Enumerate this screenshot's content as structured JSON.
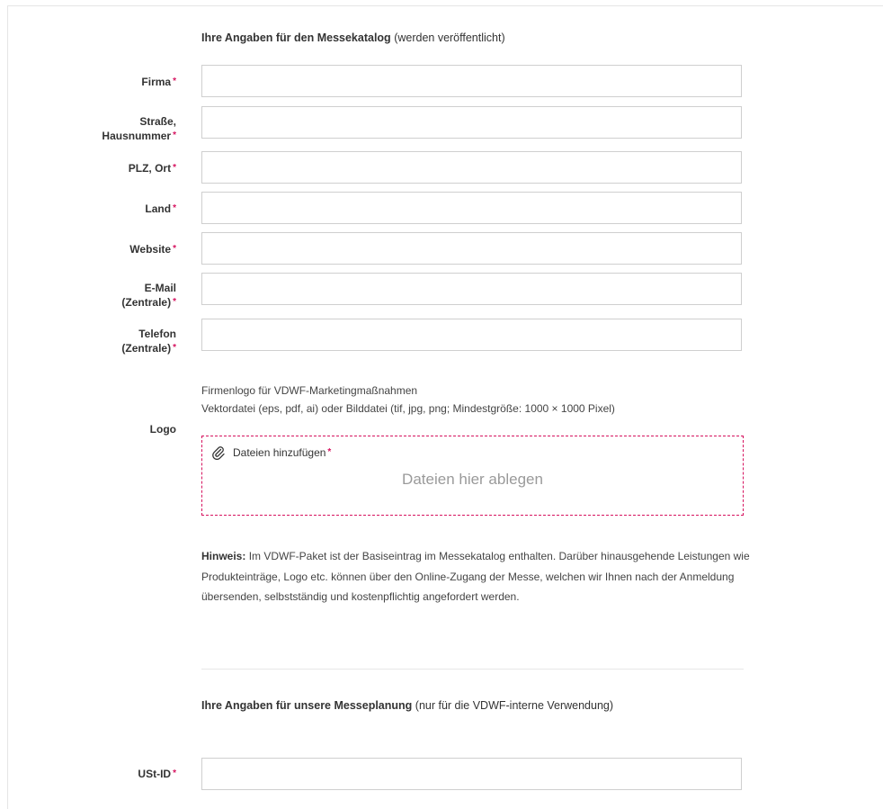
{
  "catalog_section": {
    "heading_bold": "Ihre Angaben für den Messekatalog",
    "heading_note": "(werden veröffentlicht)"
  },
  "fields": [
    {
      "label_line1": "Firma",
      "label_line2": "",
      "required_mark": "*",
      "value": ""
    },
    {
      "label_line1": "Straße,",
      "label_line2": "Hausnummer",
      "required_mark": "*",
      "value": ""
    },
    {
      "label_line1": "PLZ, Ort",
      "label_line2": "",
      "required_mark": "*",
      "value": ""
    },
    {
      "label_line1": "Land",
      "label_line2": "",
      "required_mark": "*",
      "value": ""
    },
    {
      "label_line1": "Website",
      "label_line2": "",
      "required_mark": "*",
      "value": ""
    },
    {
      "label_line1": "E-Mail",
      "label_line2": "(Zentrale)",
      "required_mark": "*",
      "value": ""
    },
    {
      "label_line1": "Telefon",
      "label_line2": "(Zentrale)",
      "required_mark": "*",
      "value": ""
    }
  ],
  "logo": {
    "label": "Logo",
    "info_line1": "Firmenlogo für VDWF-Marketingmaßnahmen",
    "info_line2": "Vektordatei (eps, pdf, ai) oder Bilddatei (tif, jpg, png; Mindestgröße: 1000 × 1000 Pixel)",
    "add_files_label": "Dateien hinzufügen",
    "required_mark": "*",
    "drop_hint": "Dateien hier ablegen",
    "icon": "paperclip-icon"
  },
  "note": {
    "bold": "Hinweis:",
    "text": "Im VDWF-Paket ist der Basiseintrag im Messekatalog enthalten. Darüber hinausgehende Leistungen wie Produkteinträge, Logo etc. können über den Online-Zugang der Messe, welchen wir Ihnen nach der Anmeldung übersenden, selbstständig und kostenpflichtig angefordert werden."
  },
  "planning_section": {
    "heading_bold": "Ihre Angaben für unsere Messeplanung",
    "heading_note": "(nur für die VDWF-interne Verwendung)"
  },
  "vat_field": {
    "label": "USt-ID",
    "required_mark": "*",
    "value": ""
  },
  "colors": {
    "accent": "#d6135f",
    "border": "#cfcfcf",
    "text": "#333333"
  }
}
